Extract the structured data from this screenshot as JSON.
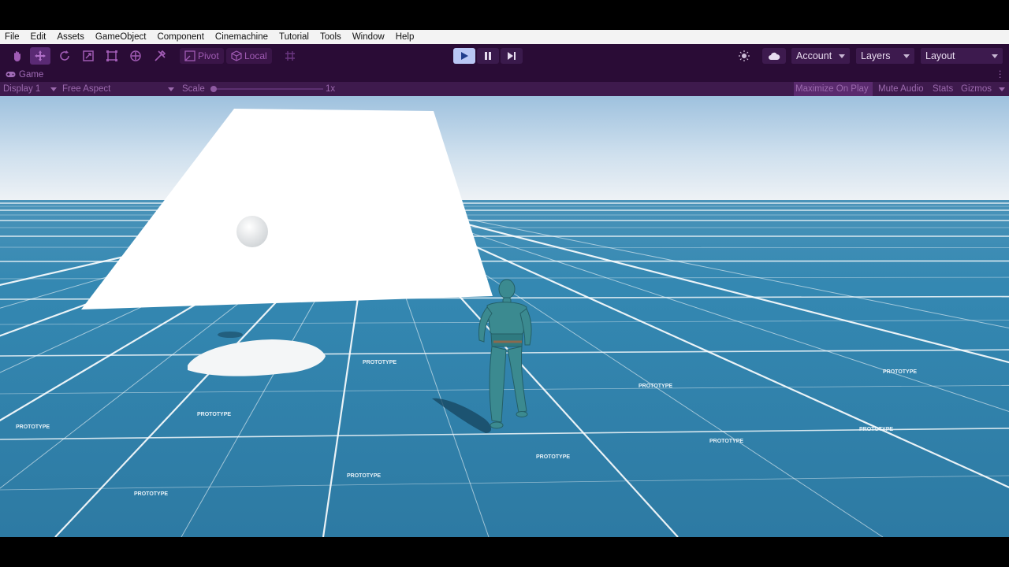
{
  "menubar": {
    "items": [
      "File",
      "Edit",
      "Assets",
      "GameObject",
      "Component",
      "Cinemachine",
      "Tutorial",
      "Tools",
      "Window",
      "Help"
    ]
  },
  "toolbar": {
    "tools": [
      "hand-icon",
      "move-icon",
      "rotate-icon",
      "scale-icon",
      "rect-transform-icon",
      "transform-icon",
      "custom-tool-icon"
    ],
    "pivot_label": "Pivot",
    "local_label": "Local",
    "grid_icon": "grid-snap-icon",
    "play_icons": [
      "play-icon",
      "pause-icon",
      "step-icon"
    ],
    "account_label": "Account",
    "layers_label": "Layers",
    "layout_label": "Layout"
  },
  "game_tab": {
    "title": "Game"
  },
  "game_bar": {
    "display": "Display 1",
    "aspect": "Free Aspect",
    "scale_label": "Scale",
    "scale_value": "1x",
    "maximize": "Maximize On Play",
    "mute": "Mute Audio",
    "stats": "Stats",
    "gizmos": "Gizmos"
  },
  "scene": {
    "floor_label": "PROTOTYPE"
  },
  "colors": {
    "toolbar_bg": "#2a0c36",
    "accent": "#a05bb4",
    "floor": "#2e7ea6",
    "sky_top": "#9ec1de",
    "character": "#3b8a90"
  }
}
